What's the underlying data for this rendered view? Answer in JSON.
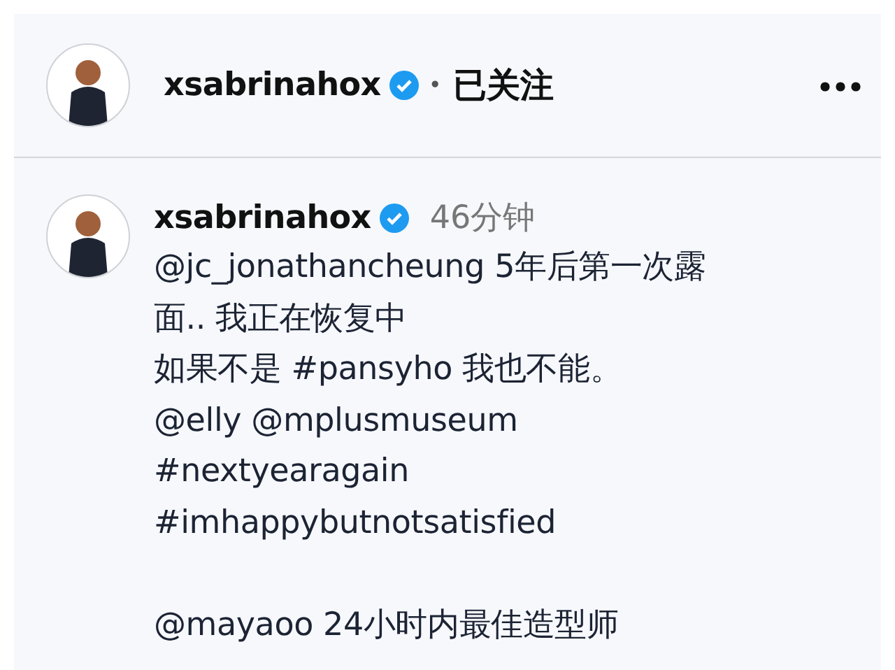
{
  "post_header": {
    "username": "xsabrinahox",
    "verified": true,
    "separator": "•",
    "follow_status": "已关注"
  },
  "comment": {
    "username": "xsabrinahox",
    "verified": true,
    "time": "46分钟",
    "paragraphs": [
      [
        "@jc_jonathancheung 5年后第一次露",
        "面.. 我正在恢复中",
        "如果不是 #pansyho 我也不能。",
        "@elly @mplusmuseum",
        "#nextyearagain",
        "#imhappybutnotsatisfied"
      ],
      [
        "@mayaoo 24小时内最佳造型师"
      ]
    ]
  }
}
